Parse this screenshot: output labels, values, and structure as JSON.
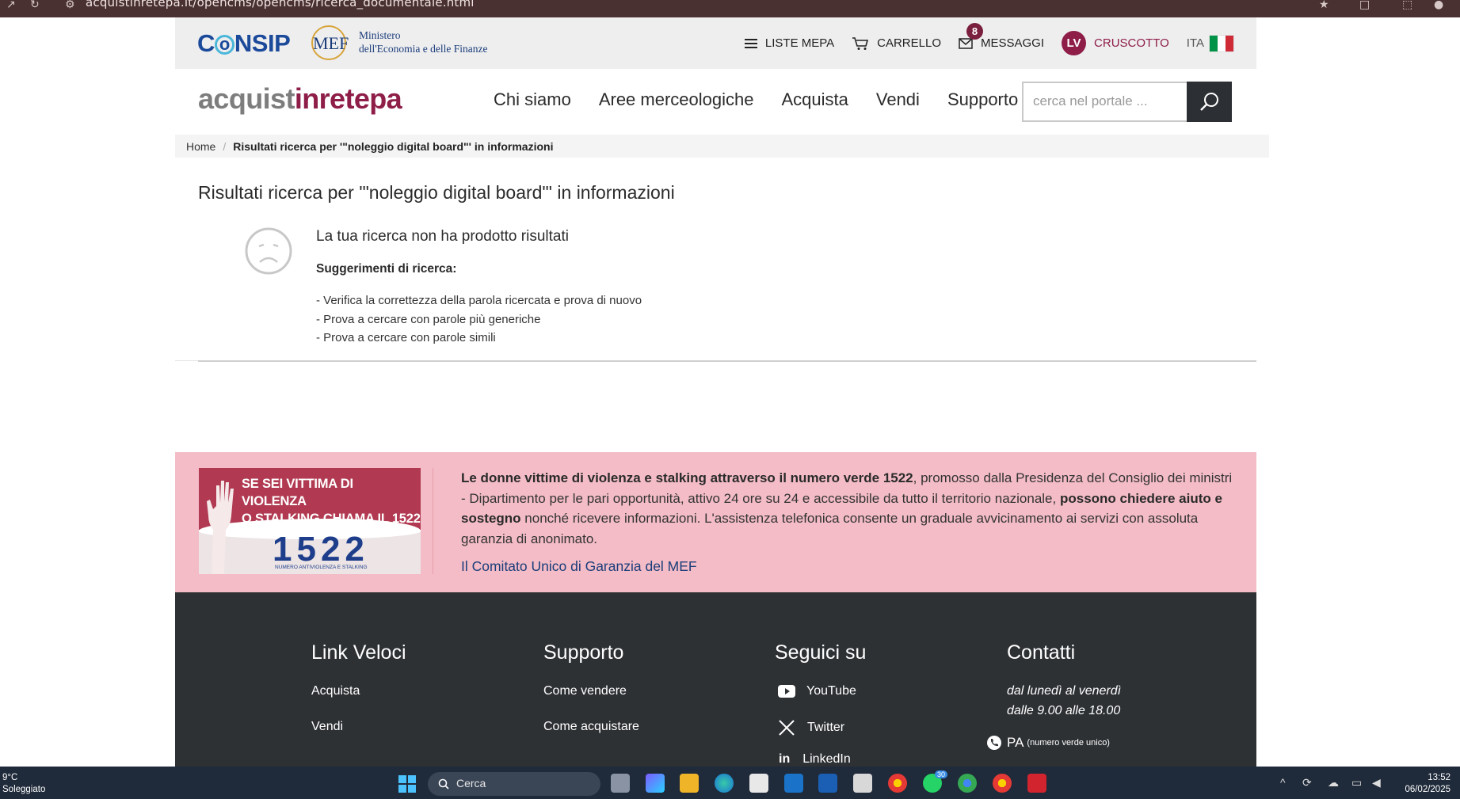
{
  "browser": {
    "url": "acquistinretepa.it/opencms/opencms/ricerca_documentale.html"
  },
  "topbar": {
    "consip_logo": "CONSIP",
    "mef_logo": "MEF",
    "mef_line1": "Ministero",
    "mef_line2": "dell'Economia e delle Finanze",
    "liste_mepa": "LISTE MEPA",
    "carrello": "CARRELLO",
    "messaggi": "MESSAGGI",
    "messaggi_count": "8",
    "user_initials": "LV",
    "cruscotto": "CRUSCOTTO",
    "lang": "ITA",
    "flag_colors": [
      "#009246",
      "#ffffff",
      "#ce2b37"
    ]
  },
  "header": {
    "logo_part1": "acquist",
    "logo_part2": "inrete",
    "logo_part3": "pa",
    "nav": [
      "Chi siamo",
      "Aree merceologiche",
      "Acquista",
      "Vendi",
      "Supporto"
    ],
    "search_placeholder": "cerca nel portale ..."
  },
  "breadcrumb": {
    "home": "Home",
    "separator": "/",
    "current": "Risultati ricerca per '\"noleggio digital board\"' in informazioni"
  },
  "results": {
    "title": "Risultati ricerca per '\"noleggio digital board\"' in informazioni",
    "no_results": "La tua ricerca non ha prodotto risultati",
    "suggestions_title": "Suggerimenti di ricerca:",
    "suggestions": [
      "- Verifica la correttezza della parola ricercata e prova di nuovo",
      "- Prova a cercare con parole più generiche",
      "- Prova a cercare con parole simili"
    ]
  },
  "banner": {
    "img_line1": "SE SEI VITTIMA DI VIOLENZA",
    "img_line2": "O STALKING CHIAMA IL 1522",
    "img_number": "1522",
    "img_sub": "NUMERO ANTIVIOLENZA E STALKING",
    "text_bold1": "Le donne vittime di violenza e stalking attraverso il numero verde 1522",
    "text_part2": ", promosso dalla Presidenza del Consiglio dei ministri - Dipartimento per le pari opportunità, attivo 24 ore su 24 e accessibile da tutto il territorio nazionale, ",
    "text_bold2": "possono chiedere aiuto e sostegno",
    "text_part3": " nonché ricevere informazioni. L'assistenza telefonica consente un graduale avvicinamento ai servizi con assoluta garanzia di anonimato.",
    "link": "Il Comitato Unico di Garanzia del MEF",
    "bg_color": "#f3bcc6"
  },
  "footer": {
    "col1": {
      "title": "Link Veloci",
      "items": [
        "Acquista",
        "Vendi"
      ]
    },
    "col2": {
      "title": "Supporto",
      "items": [
        "Come vendere",
        "Come acquistare"
      ]
    },
    "col3": {
      "title": "Seguici su",
      "items": [
        "YouTube",
        "Twitter",
        "LinkedIn"
      ]
    },
    "col4": {
      "title": "Contatti",
      "line1": "dal lunedì al venerdì",
      "line2": "dalle 9.00 alle 18.00",
      "pa": "PA",
      "pa_note": "(numero verde unico)"
    }
  },
  "taskbar": {
    "temp": "9°C",
    "weather": "Soleggiato",
    "search": "Cerca",
    "whatsapp_badge": "30",
    "time": "13:52",
    "date": "06/02/2025"
  }
}
